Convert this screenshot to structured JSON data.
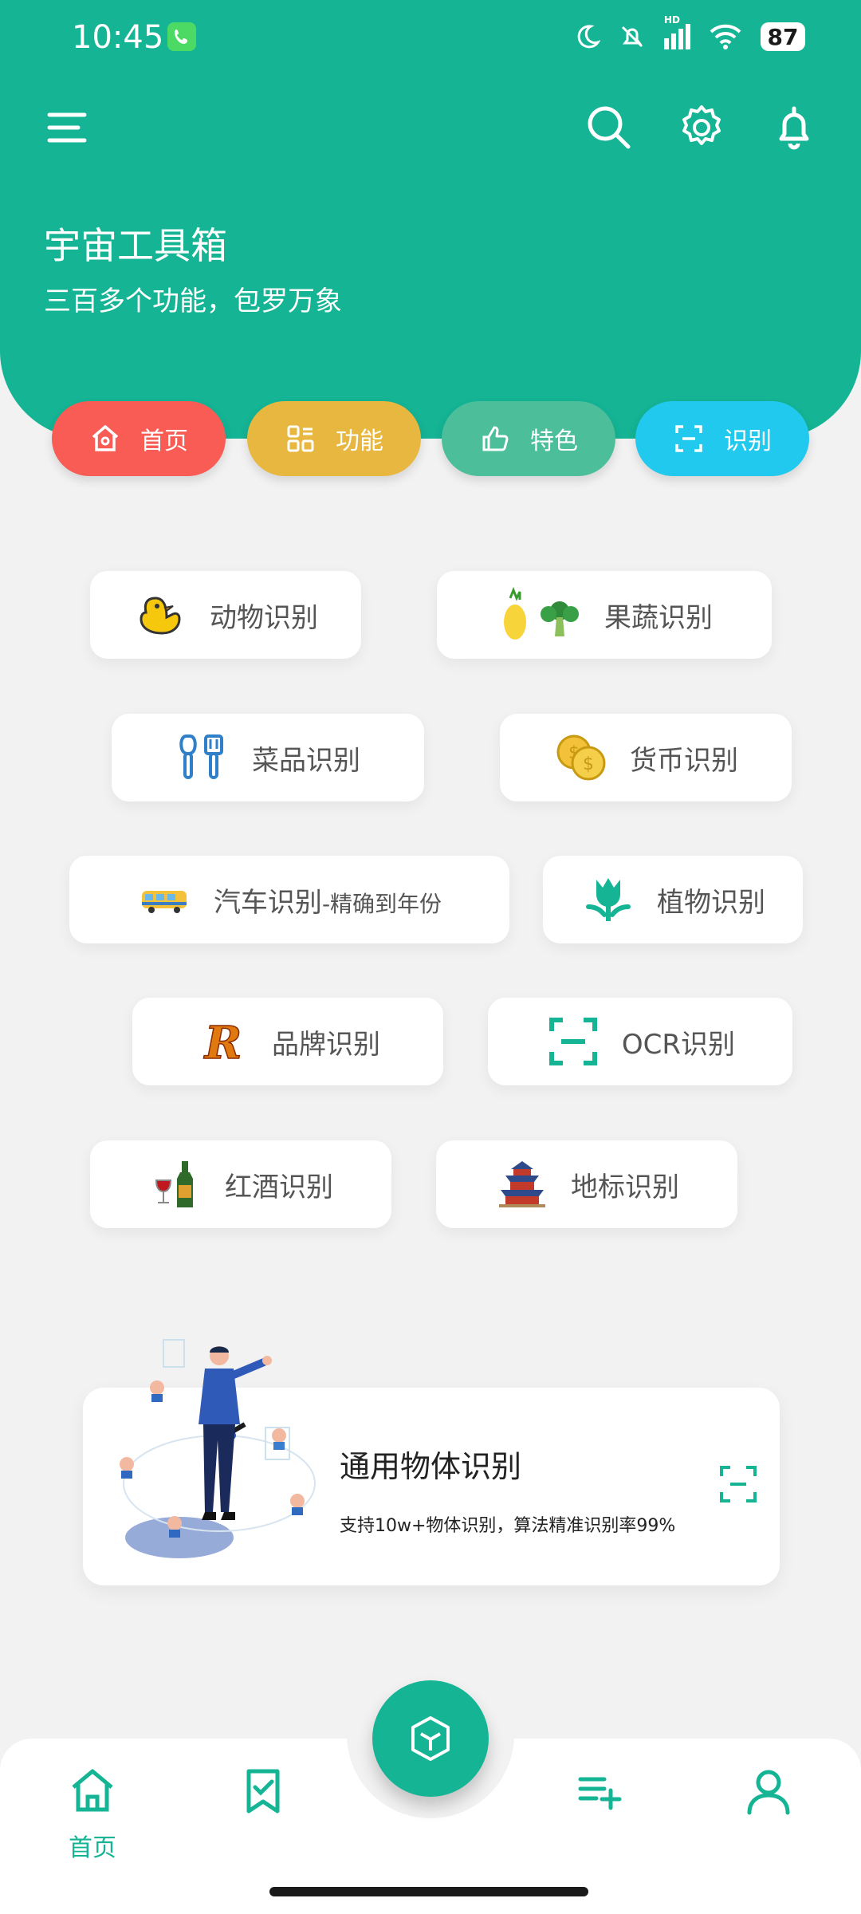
{
  "status_bar": {
    "time": "10:45",
    "battery": "87",
    "network_label": "HD"
  },
  "header": {
    "title": "宇宙工具箱",
    "subtitle": "三百多个功能，包罗万象"
  },
  "tabs": [
    {
      "label": "首页",
      "color": "#f85c55",
      "icon": "home-icon"
    },
    {
      "label": "功能",
      "color": "#e7b740",
      "icon": "grid-icon"
    },
    {
      "label": "特色",
      "color": "#4cbf9a",
      "icon": "thumbs-up-icon"
    },
    {
      "label": "识别",
      "color": "#22c9ee",
      "icon": "scan-icon"
    }
  ],
  "recognition_items": [
    {
      "label": "动物识别",
      "icon": "duck-icon"
    },
    {
      "label": "果蔬识别",
      "icon": "pineapple-broccoli-icon"
    },
    {
      "label": "菜品识别",
      "icon": "utensils-icon"
    },
    {
      "label": "货币识别",
      "icon": "coins-icon"
    },
    {
      "label": "汽车识别",
      "suffix": "-精确到年份",
      "icon": "bus-icon"
    },
    {
      "label": "植物识别",
      "icon": "tulip-icon"
    },
    {
      "label": "品牌识别",
      "icon": "brand-r-icon"
    },
    {
      "label": "OCR识别",
      "icon": "ocr-scan-icon"
    },
    {
      "label": "红酒识别",
      "icon": "wine-icon"
    },
    {
      "label": "地标识别",
      "icon": "temple-icon"
    }
  ],
  "banner": {
    "title": "通用物体识别",
    "description": "支持10w+物体识别，算法精准识别率99%"
  },
  "bottom_nav": [
    {
      "label": "首页",
      "icon": "home-icon",
      "active": true
    },
    {
      "label": "",
      "icon": "bookmark-check-icon"
    },
    {
      "label": "",
      "icon": "cube-icon"
    },
    {
      "label": "",
      "icon": "playlist-add-icon"
    },
    {
      "label": "",
      "icon": "user-icon"
    }
  ],
  "colors": {
    "primary": "#14b495",
    "background": "#f2f2f2"
  }
}
